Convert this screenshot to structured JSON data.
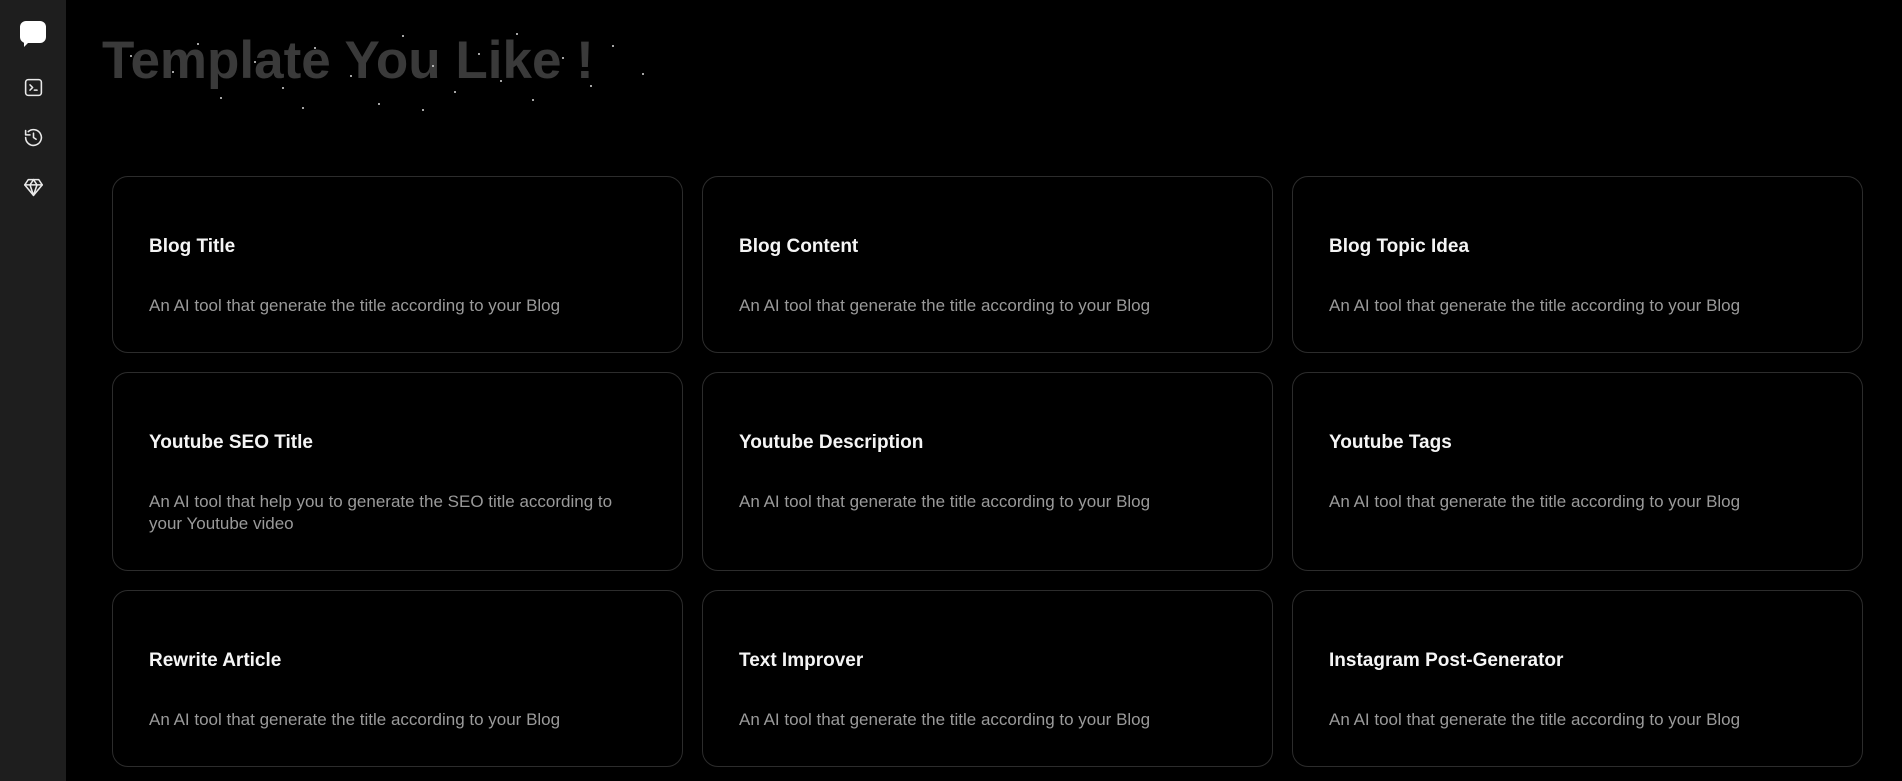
{
  "page": {
    "title": "Template You Like !"
  },
  "sidebar": {
    "icons": [
      "chat-logo-icon",
      "terminal-icon",
      "history-icon",
      "diamond-icon"
    ]
  },
  "templates": [
    {
      "title": "Blog Title",
      "description": "An AI tool that generate the title according to your Blog"
    },
    {
      "title": "Blog Content",
      "description": "An AI tool that generate the title according to your Blog"
    },
    {
      "title": "Blog Topic Idea",
      "description": "An AI tool that generate the title according to your Blog"
    },
    {
      "title": "Youtube SEO Title",
      "description": "An AI tool that help you to generate the SEO title according to your Youtube video"
    },
    {
      "title": "Youtube Description",
      "description": "An AI tool that generate the title according to your Blog"
    },
    {
      "title": "Youtube Tags",
      "description": "An AI tool that generate the title according to your Blog"
    },
    {
      "title": "Rewrite Article",
      "description": "An AI tool that generate the title according to your Blog"
    },
    {
      "title": "Text Improver",
      "description": "An AI tool that generate the title according to your Blog"
    },
    {
      "title": "Instagram Post-Generator",
      "description": "An AI tool that generate the title according to your Blog"
    }
  ],
  "colors": {
    "background": "#000000",
    "sidebar": "#1e1e1e",
    "title": "#3a3a3a",
    "card_border": "#2c2c2c",
    "description": "#9a9a9a"
  }
}
